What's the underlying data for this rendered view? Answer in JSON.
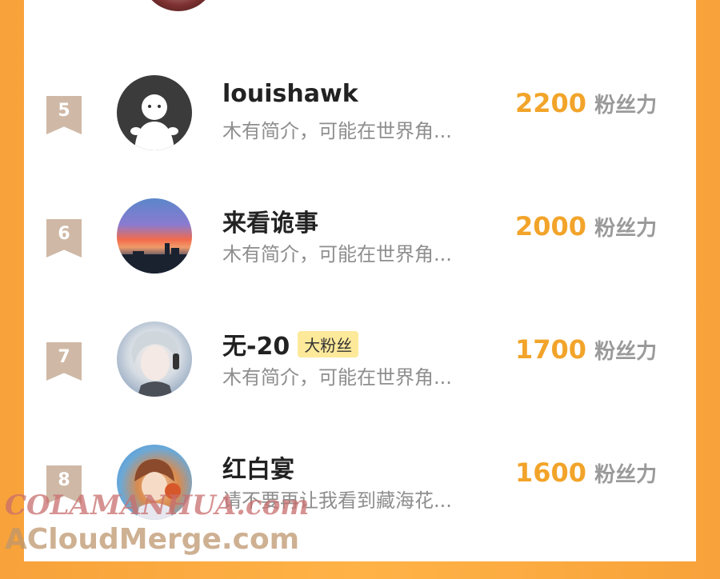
{
  "ranking": {
    "items": [
      {
        "rank": "5",
        "name": "louishawk",
        "badge": "",
        "bio": "木有简介，可能在世界角...",
        "score": "2200",
        "unit": "粉丝力"
      },
      {
        "rank": "6",
        "name": "来看诡事",
        "badge": "",
        "bio": "木有简介，可能在世界角...",
        "score": "2000",
        "unit": "粉丝力"
      },
      {
        "rank": "7",
        "name": "无-20",
        "badge": "大粉丝",
        "bio": "木有简介，可能在世界角...",
        "score": "1700",
        "unit": "粉丝力"
      },
      {
        "rank": "8",
        "name": "红白宴",
        "badge": "",
        "bio": "请不要再让我看到藏海花...",
        "score": "1600",
        "unit": "粉丝力"
      }
    ]
  },
  "watermark": {
    "line1": "COLAMANHUA.com",
    "line2": "ACloudMerge.com"
  }
}
